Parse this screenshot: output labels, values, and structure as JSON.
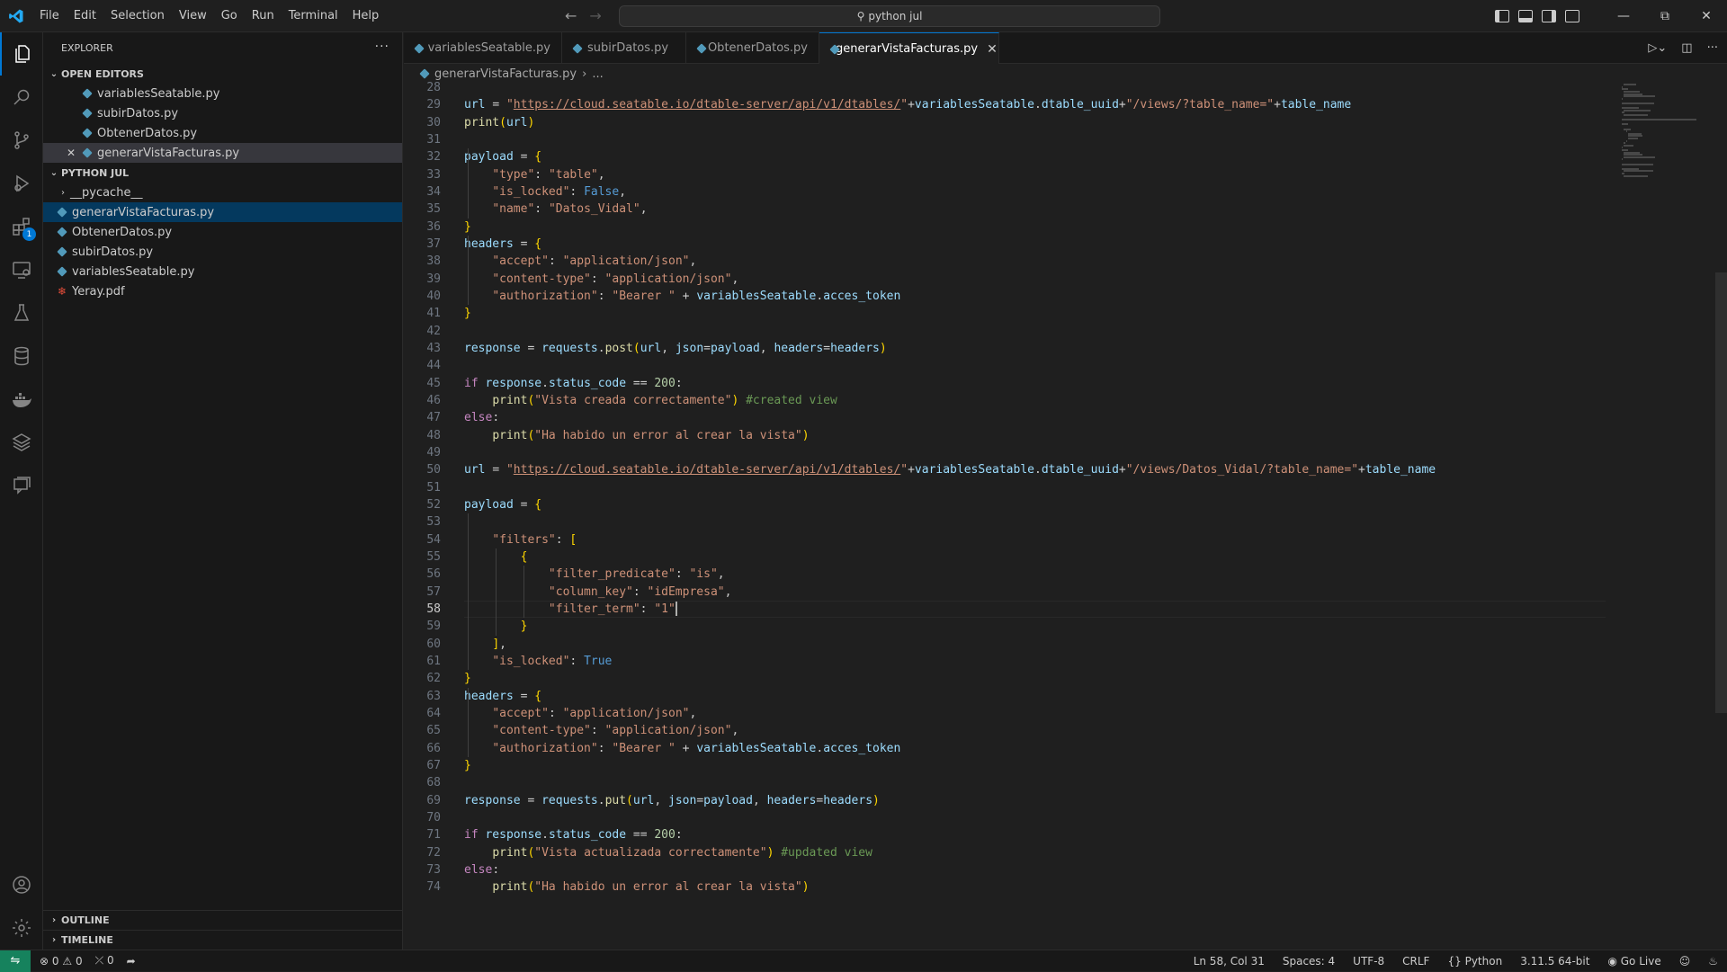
{
  "window": {
    "command_center": "python jul",
    "menu": [
      "File",
      "Edit",
      "Selection",
      "View",
      "Go",
      "Run",
      "Terminal",
      "Help"
    ]
  },
  "colors": {
    "accent": "#0078d4",
    "remote": "#16825d",
    "python_icon": "#519aba"
  },
  "activity_bar": [
    {
      "icon": "files-icon",
      "active": true
    },
    {
      "icon": "search-icon"
    },
    {
      "icon": "source-control-icon"
    },
    {
      "icon": "run-debug-icon"
    },
    {
      "icon": "extensions-icon",
      "badge": "1"
    },
    {
      "icon": "remote-explorer-icon"
    },
    {
      "icon": "testing-icon"
    },
    {
      "icon": "database-icon"
    },
    {
      "icon": "docker-icon"
    },
    {
      "icon": "stack-icon"
    },
    {
      "icon": "comments-icon"
    }
  ],
  "sidebar": {
    "title": "EXPLORER",
    "open_editors_title": "OPEN EDITORS",
    "open_editors": [
      {
        "name": "variablesSeatable.py"
      },
      {
        "name": "subirDatos.py"
      },
      {
        "name": "ObtenerDatos.py"
      },
      {
        "name": "generarVistaFacturas.py",
        "active": true
      }
    ],
    "folder_title": "PYTHON JUL",
    "files": [
      {
        "name": "__pycache__",
        "type": "folder"
      },
      {
        "name": "generarVistaFacturas.py",
        "type": "py",
        "selected": true
      },
      {
        "name": "ObtenerDatos.py",
        "type": "py"
      },
      {
        "name": "subirDatos.py",
        "type": "py"
      },
      {
        "name": "variablesSeatable.py",
        "type": "py"
      },
      {
        "name": "Yeray.pdf",
        "type": "pdf"
      }
    ],
    "outline_title": "OUTLINE",
    "timeline_title": "TIMELINE"
  },
  "tabs": [
    {
      "label": "variablesSeatable.py"
    },
    {
      "label": "subirDatos.py"
    },
    {
      "label": "ObtenerDatos.py"
    },
    {
      "label": "generarVistaFacturas.py",
      "active": true
    }
  ],
  "breadcrumb": {
    "file": "generarVistaFacturas.py",
    "rest": "..."
  },
  "editor": {
    "first_line": 28,
    "current_line": 58,
    "lines": [
      "",
      "url = \"https://cloud.seatable.io/dtable-server/api/v1/dtables/\"+variablesSeatable.dtable_uuid+\"/views/?table_name=\"+table_name",
      "print(url)",
      "",
      "payload = {",
      "    \"type\": \"table\",",
      "    \"is_locked\": False,",
      "    \"name\": \"Datos_Vidal\",",
      "}",
      "headers = {",
      "    \"accept\": \"application/json\",",
      "    \"content-type\": \"application/json\",",
      "    \"authorization\": \"Bearer \" + variablesSeatable.acces_token",
      "}",
      "",
      "response = requests.post(url, json=payload, headers=headers)",
      "",
      "if response.status_code == 200:",
      "    print(\"Vista creada correctamente\") #created view",
      "else:",
      "    print(\"Ha habido un error al crear la vista\")",
      "",
      "url = \"https://cloud.seatable.io/dtable-server/api/v1/dtables/\"+variablesSeatable.dtable_uuid+\"/views/Datos_Vidal/?table_name=\"+table_name",
      "",
      "payload = {",
      "",
      "    \"filters\": [",
      "        {",
      "            \"filter_predicate\": \"is\",",
      "            \"column_key\": \"idEmpresa\",",
      "            \"filter_term\": \"1\"",
      "        }",
      "    ],",
      "    \"is_locked\": True",
      "}",
      "headers = {",
      "    \"accept\": \"application/json\",",
      "    \"content-type\": \"application/json\",",
      "    \"authorization\": \"Bearer \" + variablesSeatable.acces_token",
      "}",
      "",
      "response = requests.put(url, json=payload, headers=headers)",
      "",
      "if response.status_code == 200:",
      "    print(\"Vista actualizada correctamente\") #updated view",
      "else:",
      "    print(\"Ha habido un error al crear la vista\")"
    ]
  },
  "status": {
    "errors": "0",
    "warnings": "0",
    "ports": "0",
    "position": "Ln 58, Col 31",
    "spaces": "Spaces: 4",
    "encoding": "UTF-8",
    "eol": "CRLF",
    "language": "Python",
    "interpreter": "3.11.5 64-bit",
    "golive": "Go Live"
  }
}
